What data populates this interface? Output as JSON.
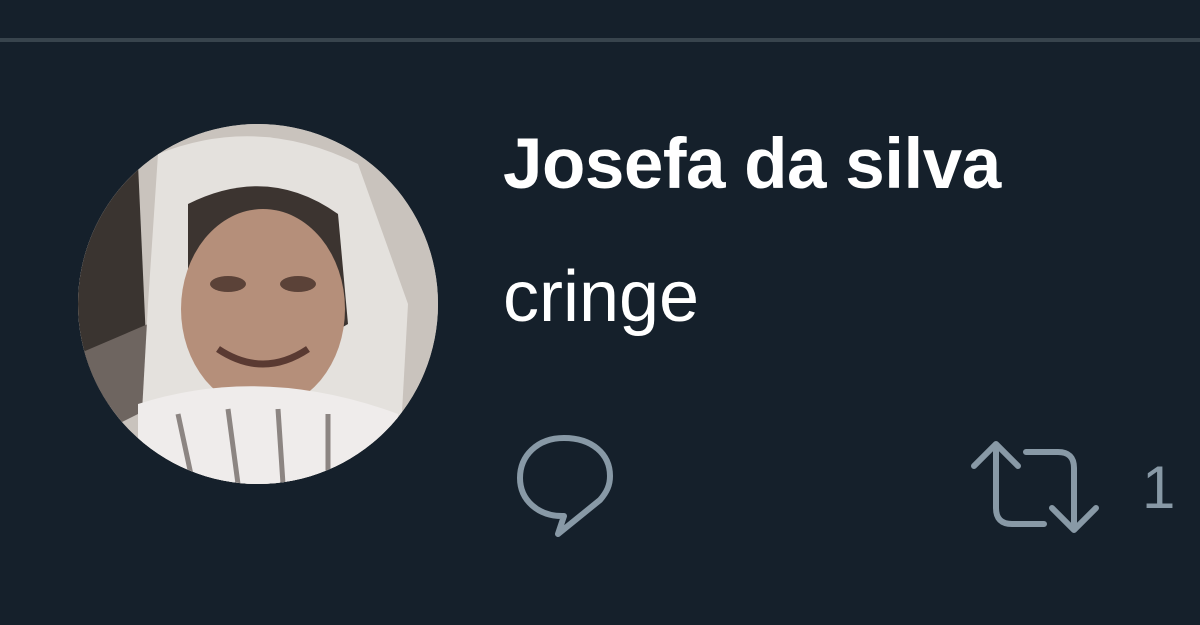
{
  "tweet": {
    "author_name": "Josefa da silva",
    "text": "cringe",
    "avatar_icon": "user-avatar-photo",
    "actions": {
      "reply_icon": "reply-icon",
      "retweet_icon": "retweet-icon",
      "retweet_count": "1"
    }
  },
  "colors": {
    "background": "#15202b",
    "divider": "#38444d",
    "text": "#ffffff",
    "icon": "#8899a6"
  }
}
